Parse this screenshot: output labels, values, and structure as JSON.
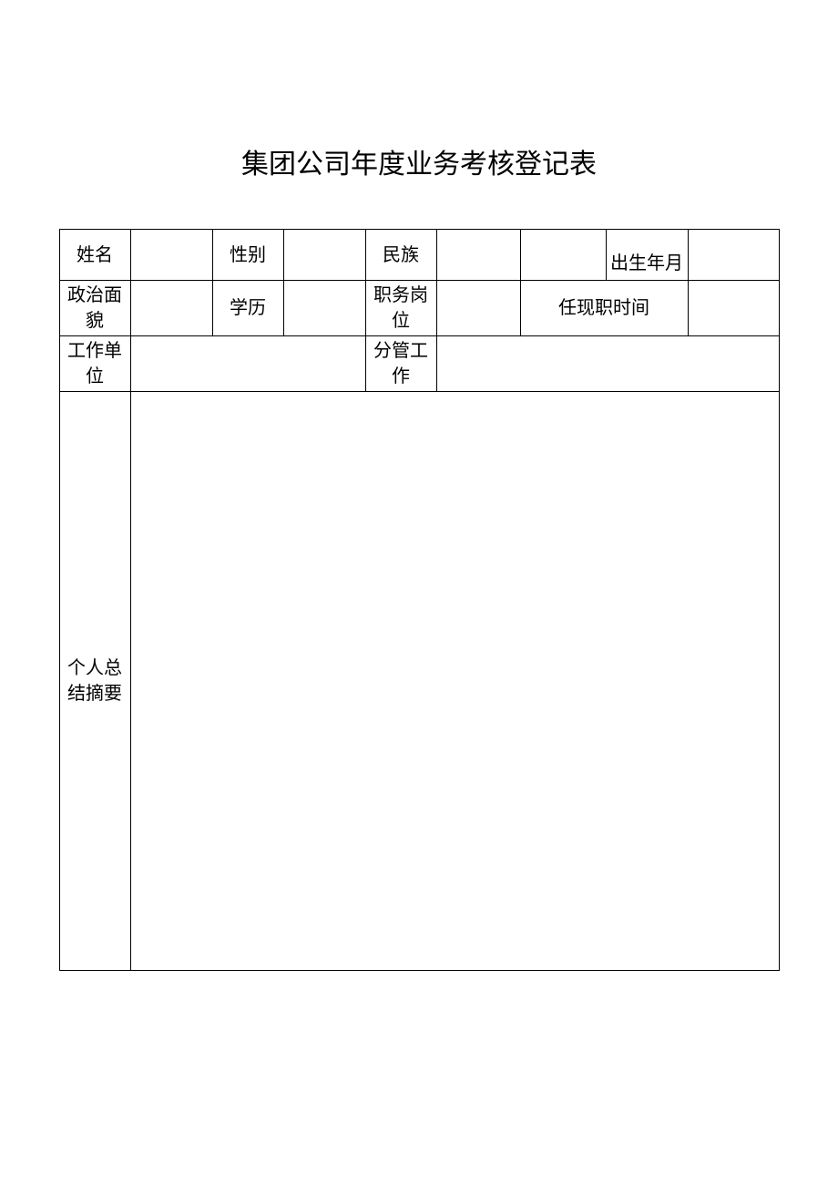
{
  "title": "集团公司年度业务考核登记表",
  "labels": {
    "name": "姓名",
    "gender": "性别",
    "ethnicity": "民族",
    "dob": "出生年月",
    "political": "政治面貌",
    "education": "学历",
    "position": "职务岗位",
    "tenure": "任现职时间",
    "workunit": "工作单位",
    "responsible": "分管工作",
    "summary_line1": "个人总",
    "summary_line2": "结摘要"
  },
  "values": {
    "name": "",
    "gender": "",
    "ethnicity": "",
    "dob_before": "",
    "dob": "",
    "political": "",
    "education": "",
    "position": "",
    "tenure": "",
    "workunit": "",
    "responsible": "",
    "summary": ""
  }
}
